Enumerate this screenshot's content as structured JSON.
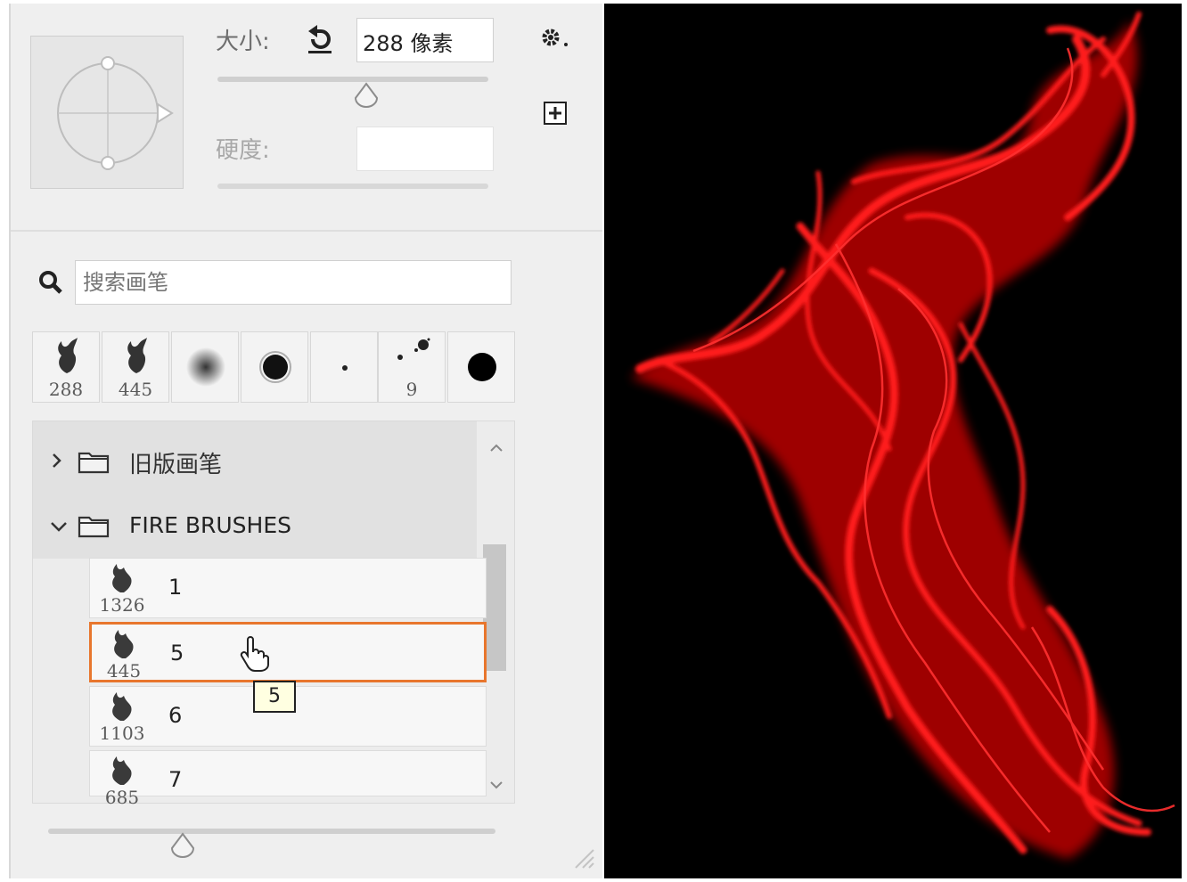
{
  "size": {
    "label": "大小:",
    "value": "288 像素",
    "slider_level": 0.55
  },
  "hardness": {
    "label": "硬度:",
    "value": ""
  },
  "search": {
    "placeholder": "搜索画笔"
  },
  "recent_brushes": [
    {
      "type": "fire",
      "label": "288"
    },
    {
      "type": "fire",
      "label": "445"
    },
    {
      "type": "soft-round",
      "label": ""
    },
    {
      "type": "hard-round-medium",
      "label": ""
    },
    {
      "type": "dot",
      "label": ""
    },
    {
      "type": "scatter",
      "label": "9"
    },
    {
      "type": "hard-round-large",
      "label": ""
    }
  ],
  "groups": [
    {
      "name": "旧版画笔",
      "expanded": false
    },
    {
      "name": "FIRE BRUSHES",
      "expanded": true
    }
  ],
  "brushes": [
    {
      "name": "1",
      "count": "1326",
      "selected": false
    },
    {
      "name": "5",
      "count": "445",
      "selected": true
    },
    {
      "name": "6",
      "count": "1103",
      "selected": false
    },
    {
      "name": "7",
      "count": "685",
      "selected": false
    }
  ],
  "tooltip": {
    "text": "5"
  },
  "preview_size_level": 0.3,
  "colors": {
    "accent": "#e8762d",
    "flame": "#ff1a1a",
    "canvas": "#000000",
    "tooltip_bg": "#ffffe1"
  },
  "icons": [
    "reset-icon",
    "gear-icon",
    "new-preset-icon",
    "search-icon",
    "folder-icon",
    "chevron-right-icon",
    "chevron-down-icon",
    "hand-cursor-icon",
    "resize-grip-icon"
  ]
}
